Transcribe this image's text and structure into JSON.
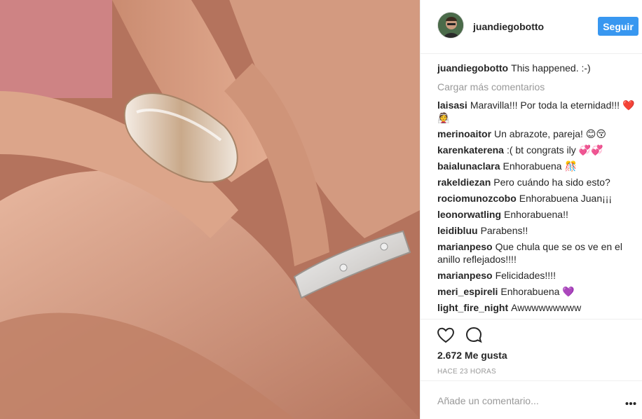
{
  "photo": {
    "alt_icon": "wedding-rings-photo"
  },
  "header": {
    "username": "juandiegobotto",
    "follow_label": "Seguir"
  },
  "caption": {
    "user": "juandiegobotto",
    "text": "This happened. :-)"
  },
  "load_more": "Cargar más comentarios",
  "comments": [
    {
      "user": "laisasi",
      "text": "Maravilla!!! Por toda la eternidad!!! ❤️👰"
    },
    {
      "user": "merinoaitor",
      "text": "Un abrazote, pareja! 😊😚"
    },
    {
      "user": "karenkaterena",
      "text": ":( bt congrats ily 💞💞"
    },
    {
      "user": "baialunaclara",
      "text": "Enhorabuena 🎊"
    },
    {
      "user": "rakeldiezan",
      "text": "Pero cuándo ha sido esto?"
    },
    {
      "user": "rociomunozcobo",
      "text": "Enhorabuena Juan¡¡¡"
    },
    {
      "user": "leonorwatling",
      "text": "Enhorabuena!!"
    },
    {
      "user": "leidibluu",
      "text": "Parabens!!"
    },
    {
      "user": "marianpeso",
      "text": "Que chula que se os ve en el anillo reflejados!!!!"
    },
    {
      "user": "marianpeso",
      "text": "Felicidades!!!!"
    },
    {
      "user": "meri_espireli",
      "text": "Enhorabuena 💜"
    },
    {
      "user": "light_fire_night",
      "text": "Awwwwwwwww"
    }
  ],
  "actions": {
    "like_icon": "heart-icon",
    "comment_icon": "comment-icon"
  },
  "likes": "2.672 Me gusta",
  "time": "HACE 23 HORAS",
  "add_comment": {
    "placeholder": "Añade un comentario..."
  },
  "colors": {
    "accent": "#3897f0",
    "muted": "#999999",
    "text": "#262626",
    "border": "#efefef"
  }
}
